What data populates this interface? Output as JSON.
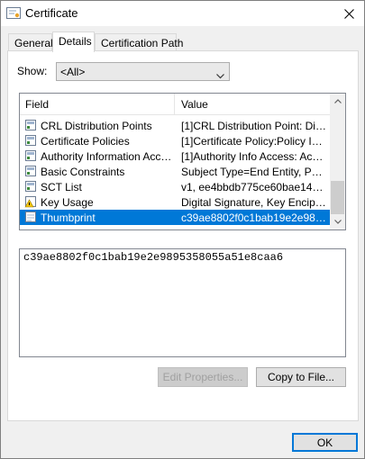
{
  "window": {
    "title": "Certificate"
  },
  "tabs": [
    {
      "label": "General",
      "active": false
    },
    {
      "label": "Details",
      "active": true
    },
    {
      "label": "Certification Path",
      "active": false
    }
  ],
  "show": {
    "label": "Show:",
    "selected": "<All>"
  },
  "list": {
    "columns": {
      "field": "Field",
      "value": "Value"
    },
    "rows": [
      {
        "field": "CRL Distribution Points",
        "value": "[1]CRL Distribution Point: Distr...",
        "icon": "cert-field-icon",
        "selected": false
      },
      {
        "field": "Certificate Policies",
        "value": "[1]Certificate Policy:Policy Ide...",
        "icon": "cert-field-icon",
        "selected": false
      },
      {
        "field": "Authority Information Access",
        "value": "[1]Authority Info Access: Acc...",
        "icon": "cert-field-icon",
        "selected": false
      },
      {
        "field": "Basic Constraints",
        "value": "Subject Type=End Entity, Pat...",
        "icon": "cert-field-icon",
        "selected": false
      },
      {
        "field": "SCT List",
        "value": "v1, ee4bbdb775ce60bae1426...",
        "icon": "cert-field-icon",
        "selected": false
      },
      {
        "field": "Key Usage",
        "value": "Digital Signature, Key Encipher...",
        "icon": "warning-field-icon",
        "selected": false
      },
      {
        "field": "Thumbprint",
        "value": "c39ae8802f0c1bab19e2e9895...",
        "icon": "property-field-icon",
        "selected": true
      }
    ]
  },
  "detail": {
    "text": "c39ae8802f0c1bab19e2e9895358055a51e8caa6"
  },
  "buttons": {
    "edit_properties": "Edit Properties...",
    "copy_to_file": "Copy to File...",
    "ok": "OK"
  },
  "colors": {
    "selection": "#0078d7",
    "dialog_bg": "#f0f0f0"
  }
}
